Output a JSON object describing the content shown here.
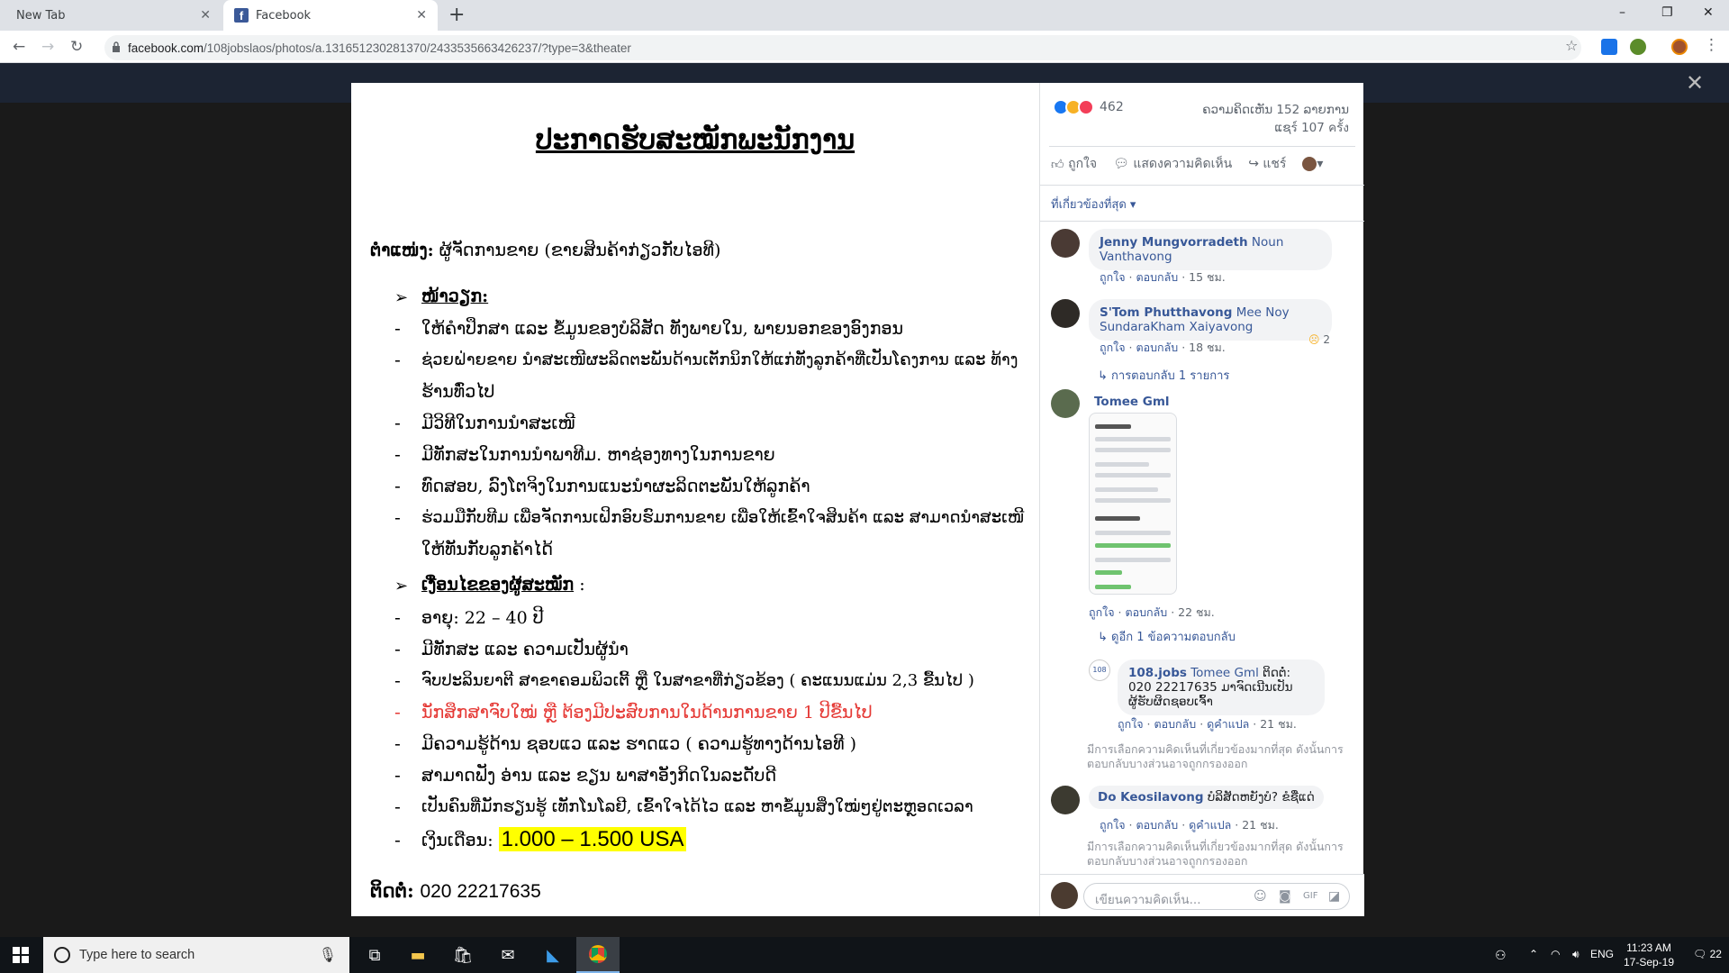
{
  "browser": {
    "tabs": [
      {
        "title": "New Tab",
        "active": false
      },
      {
        "title": "Facebook",
        "active": true
      }
    ],
    "url_domain": "facebook.com",
    "url_path": "/108jobslaos/photos/a.131651230281370/2433535663426237/?type=3&theater",
    "window_controls": [
      "–",
      "❐",
      "✕"
    ]
  },
  "overlay": {
    "close_glyph": "✕"
  },
  "post_image": {
    "title": "ປະກາດຮັບສະໝັກພະນັກງານ",
    "position_label": "ຕຳແໜ່ງ:",
    "position_value": "ຜູ້ຈັດການຂາຍ (ຂາຍສິນຄ້າກ່ຽວກັບໄອທີ)",
    "duties_header": "ໜ້າວຽກ:",
    "duties": [
      "ໃຫ້ຄຳປຶກສາ ແລະ ຂໍ້ມູນຂອງບໍລິສັດ ທັງພາຍໃນ, ພາຍນອກຂອງອົງກອນ",
      "ຊ່ວຍຝ່າຍຂາຍ ນຳສະເໜີຜະລິດຕະພັນດ້ານເຕັກນິກໃຫ້ແກ່ທັງລູກຄ້າທີ່ເປັນໂຄງການ ແລະ ທ້າງ",
      "ຮ້ານທົ່ວໄປ",
      "ມີວິທີໃນການນຳສະເໜີ",
      "ມີທັກສະໃນການນຳພາທີມ. ຫາຊ່ອງທາງໃນການຂາຍ",
      "ທົດສອບ, ລົງໂຕຈິງໃນການແນະນຳຜະລິດຕະພັນໃຫ້ລູກຄ້າ",
      "ຮ່ວມມືກັບທີມ ເພື່ອຈັດການເຝິກອົບຮົມການຂາຍ ເພື່ອໃຫ້ເຂົ້າໃຈສິນຄ້າ ແລະ ສາມາດນຳສະເໜີ",
      "ໃຫ້ທັນກັບລູກຄ້າໄດ້"
    ],
    "requirements_header": "ເງື່ອນໄຂຂອງຜູ້ສະໝັກ",
    "requirements_colon": ":",
    "requirements": [
      "ອາຍຸ: 22 – 40 ປີ",
      "ມີທັກສະ ແລະ ຄວາມເປັນຜູ້ນຳ",
      "ຈົບປະລິນຍາຕີ ສາຂາຄອມພິວເຕີ້ ຫຼື ໃນສາຂາທີ່ກ່ຽວຂ້ອງ ( ຄະແນນແມ່ນ 2,3 ຂື້ນໄປ )",
      "ນັກສຶກສາຈົບໃໝ່ ຫຼື ຕ້ອງມີປະສົບການໃນດ້ານການຂາຍ 1 ປີຂື້ນໄປ",
      "ມີຄວາມຮູ້ດ້ານ ຊອບແວ ແລະ ຮາດແວ ( ຄວາມຮູ້ທາງດ້ານໄອທີ )",
      "ສາມາດຟັງ ອ່ານ ແລະ ຂຽນ ພາສາອັງກິດໃນລະດັບດີ",
      "ເປັນຄົນທີ່ມັກຮຽນຮູ້ ເທັກໂນໂລຢີ, ເຂົ້າໃຈໄດ້ໄວ ແລະ ຫາຂໍ້ມູນສິ່ງໃໝ່ໆຢູ່ຕະຫຼອດເວລາ"
    ],
    "salary_label": "ເງິນເດືອນ:",
    "salary_value": "1.000 – 1.500 USA",
    "contact_label": "ຕິດຕໍ່:",
    "contact_value": "020  22217635",
    "bullet_glyph": "➢",
    "dash_glyph": "-"
  },
  "side": {
    "reaction_count": "462",
    "comments_count": "ຄວາມຄິດເຫັນ 152 ລາຍການ",
    "shares_count": "ແຊร์ 107 ครั้ง",
    "like_label": "ถูกใจ",
    "comment_label": "แสดงความคิดเห็น",
    "share_label": "แชร์",
    "relevant_label": "ที่เกี่ยวข้องที่สุด ▾",
    "comments": [
      {
        "name": "Jenny Mungvorradeth",
        "text": "Noun Vanthavong",
        "meta_like": "ถูกใจ",
        "meta_reply": "ตอบกลับ",
        "meta_time": "15 ชม."
      },
      {
        "name": "S'Tom Phutthavong",
        "text": "Mee Noy SundaraKham Xaiyavong",
        "meta_like": "ถูกใจ",
        "meta_reply": "ตอบกลับ",
        "meta_time": "18 ชม.",
        "reaction_count": "2",
        "replies_link": "↳ การตอบกลับ 1 รายการ"
      },
      {
        "name": "Tomee Gml",
        "meta_like": "ถูกใจ",
        "meta_reply": "ตอบกลับ",
        "meta_time": "22 ชม.",
        "replies_link": "↳ ดูอีก 1 ข้อความตอบกลับ"
      },
      {
        "name": "108.jobs",
        "mention": "Tomee Gml",
        "text": "ຕິດຕໍ່: 020 22217635 ມາຈົດເນີນເປັນຜູ້ຮັບຜິດຊອບເຈົ້າ",
        "meta_like": "ถูกใจ",
        "meta_reply": "ตอบกลับ",
        "meta_translate": "ดูคำแปล",
        "meta_time": "21 ชม."
      },
      {
        "name": "Do Keosilavong",
        "text": "ບໍລິສັດຫຍັງບໍ? ຂໍຊື່ແດ່",
        "meta_like": "ถูกใจ",
        "meta_reply": "ตอบกลับ",
        "meta_translate": "ดูคำแปล",
        "meta_time": "21 ชม."
      }
    ],
    "filter_note": "มีการเลือกความคิดเห็นที่เกี่ยวข้องมากที่สุด ดังนั้นการตอบกลับบางส่วนอาจถูกกรองออก",
    "composer_placeholder": "เขียนความคิดเห็น..."
  },
  "taskbar": {
    "search_placeholder": "Type here to search",
    "language": "ENG",
    "time": "11:23 AM",
    "date": "17-Sep-19",
    "notif_count": "22"
  },
  "colors": {
    "link": "#385898",
    "highlight": "#ffff00",
    "red_text": "#e53935",
    "fb_blue": "#3b5998"
  }
}
